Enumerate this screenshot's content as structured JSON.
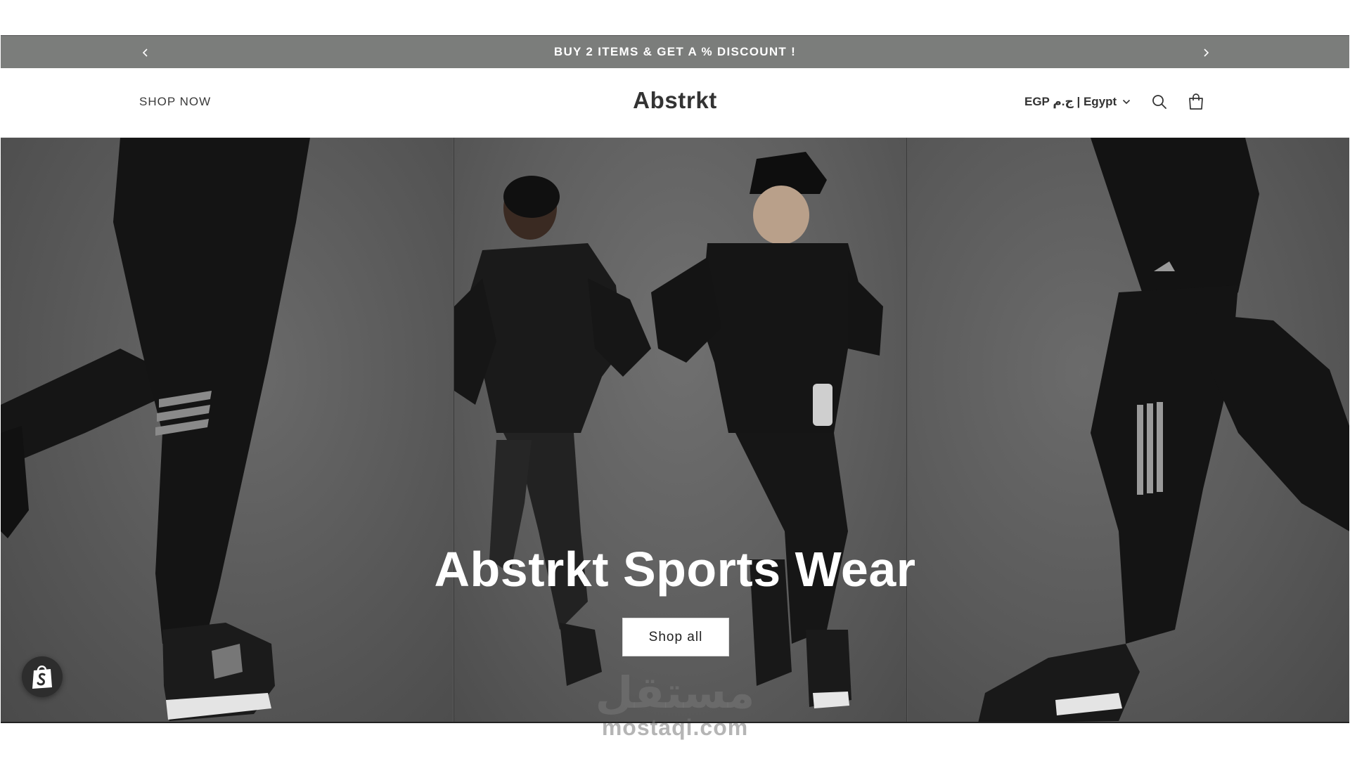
{
  "announcement": {
    "text": "BUY 2 ITEMS & GET A % DISCOUNT !",
    "prev_icon": "chevron-left-icon",
    "next_icon": "chevron-right-icon"
  },
  "header": {
    "nav_link": "SHOP NOW",
    "brand": "Abstrkt",
    "country_selector": "EGP ج.م | Egypt",
    "search_icon": "search-icon",
    "cart_icon": "cart-icon"
  },
  "hero": {
    "title": "Abstrkt Sports Wear",
    "cta_label": "Shop all"
  },
  "watermark": {
    "arabic": "مستقل",
    "latin": "mostaqi.com"
  },
  "colors": {
    "announcement_bg": "#7b7d7b",
    "hero_bg": "#595959",
    "apparel": "#151515"
  }
}
